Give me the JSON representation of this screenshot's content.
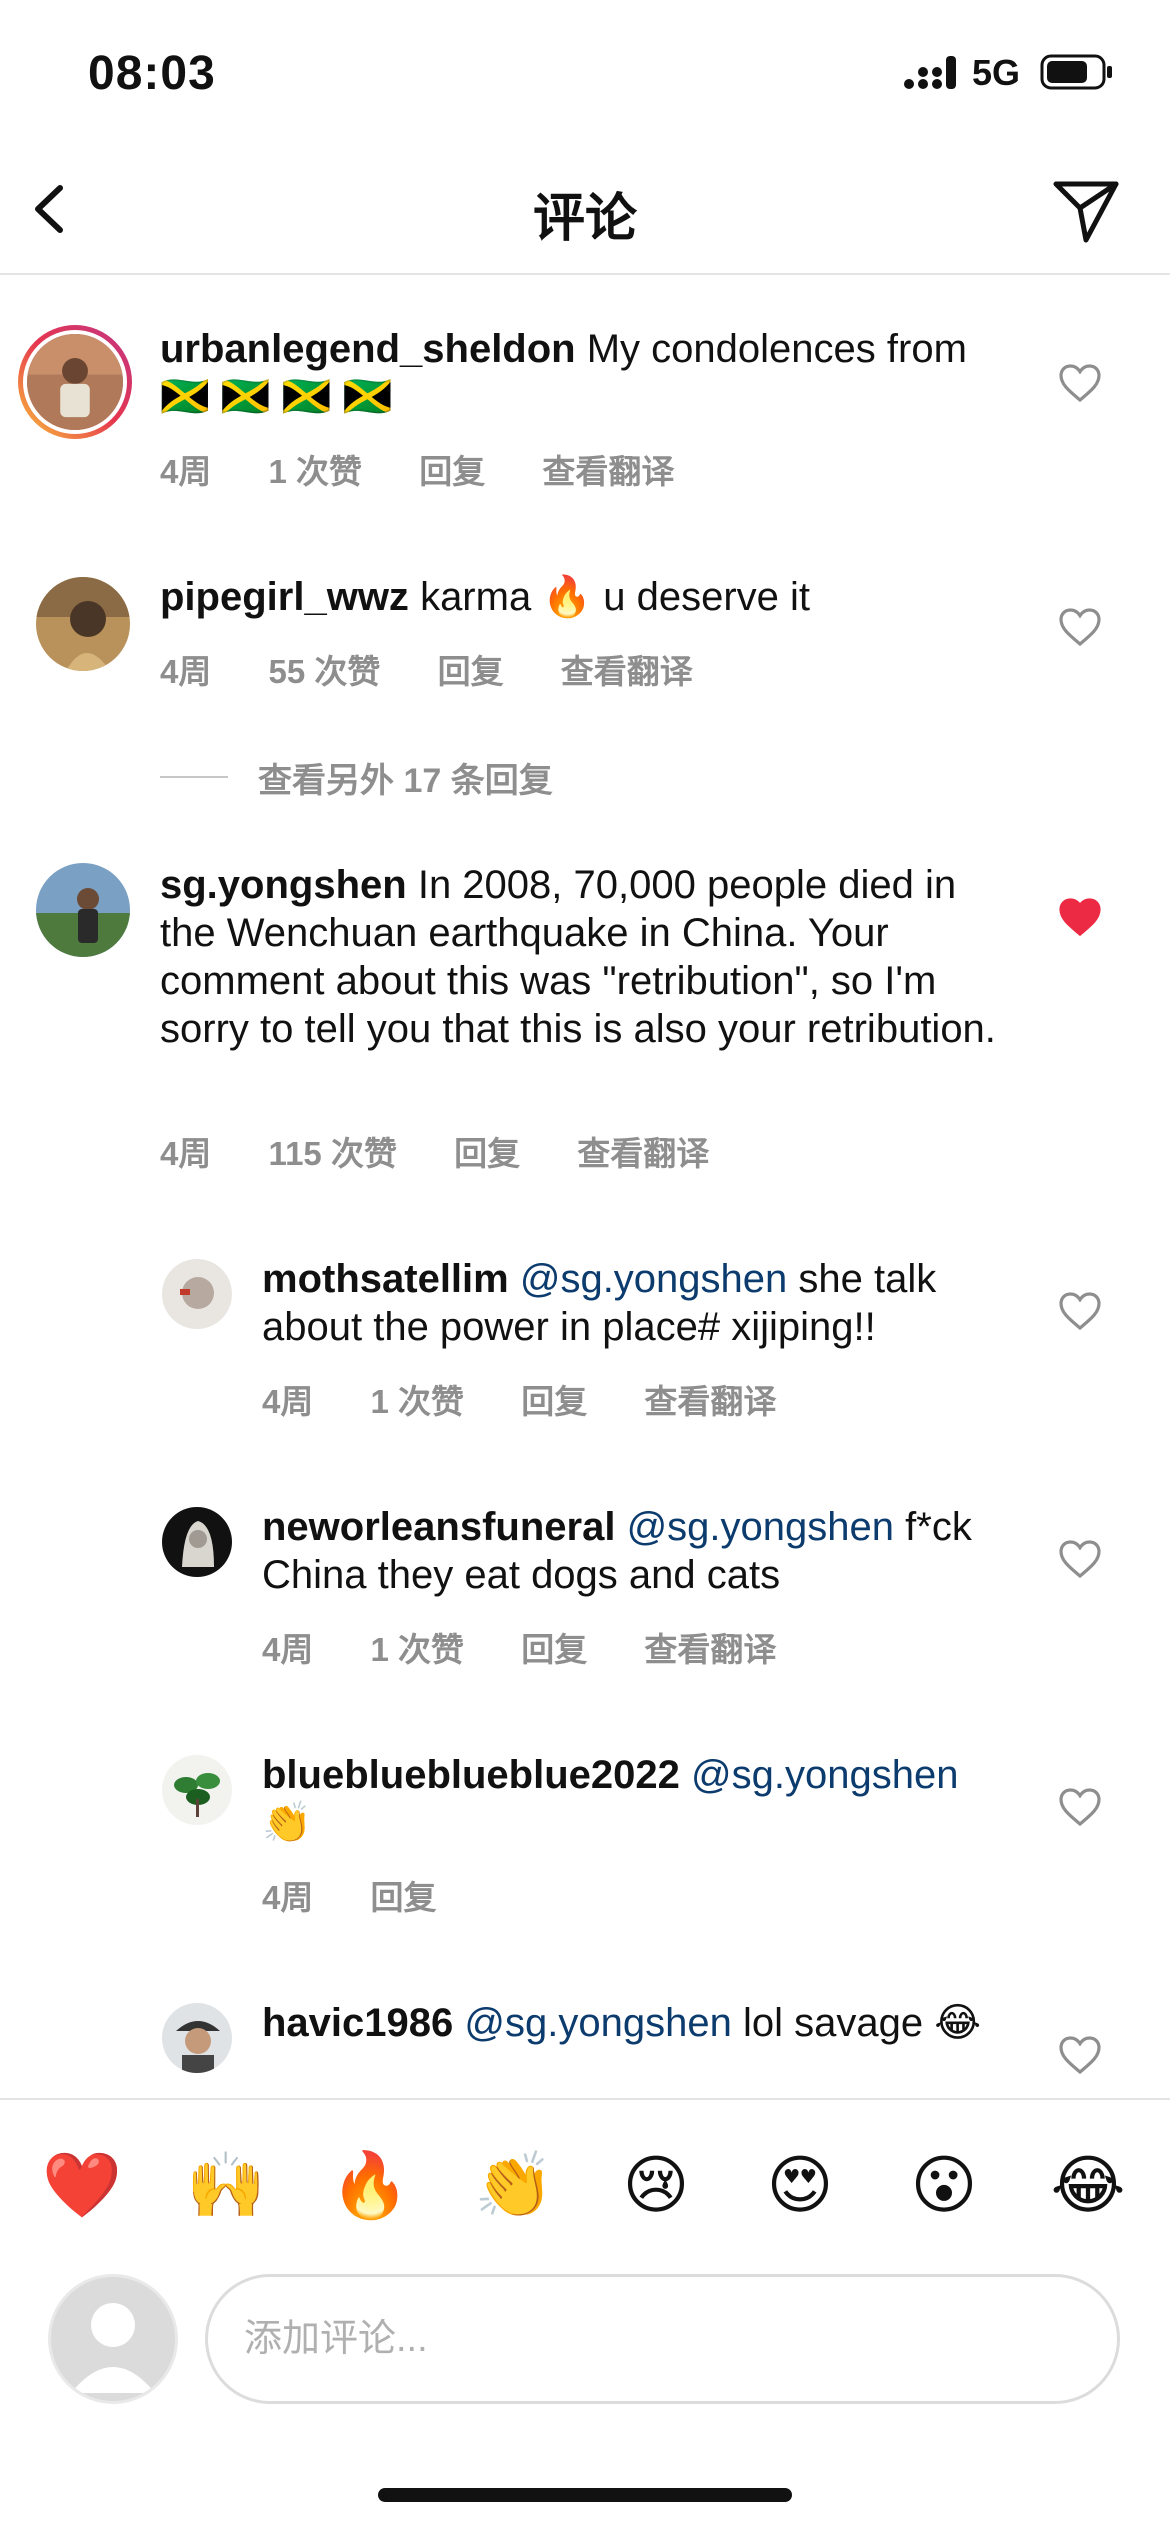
{
  "status_bar": {
    "time": "08:03",
    "network": "5G"
  },
  "header": {
    "title": "评论"
  },
  "comments": [
    {
      "username": "urbanlegend_sheldon",
      "text": "My condolences from 🇯🇲 🇯🇲 🇯🇲 🇯🇲",
      "time": "4周",
      "likes": "1 次赞",
      "reply": "回复",
      "translate": "查看翻译",
      "liked": false
    },
    {
      "username": "pipegirl_wwz",
      "text": "karma 🔥 u deserve it",
      "time": "4周",
      "likes": "55 次赞",
      "reply": "回复",
      "translate": "查看翻译",
      "liked": false
    },
    {
      "username": "sg.yongshen",
      "text": "In 2008, 70,000 people died in the Wenchuan earthquake in China. Your comment about this was \"retribution\", so I'm sorry to tell you that this is also your retribution.",
      "time": "4周",
      "likes": "115 次赞",
      "reply": "回复",
      "translate": "查看翻译",
      "liked": true
    }
  ],
  "more_replies": "查看另外 17 条回复",
  "replies": [
    {
      "username": "mothsatellim",
      "mention": "@sg.yongshen",
      "text": "she talk about the power in place# xijiping!!",
      "time": "4周",
      "likes": "1 次赞",
      "reply": "回复",
      "translate": "查看翻译"
    },
    {
      "username": "neworleansfuneral",
      "mention": "@sg.yongshen",
      "text": "f*ck China they eat dogs and cats",
      "time": "4周",
      "likes": "1 次赞",
      "reply": "回复",
      "translate": "查看翻译"
    },
    {
      "username": "blueblueblueblue2022",
      "mention": "@sg.yongshen",
      "text": "👏",
      "time": "4周",
      "reply": "回复"
    },
    {
      "username": "havic1986",
      "mention": "@sg.yongshen",
      "text": "lol savage 😂"
    }
  ],
  "emoji_bar": [
    "❤️",
    "🙌",
    "🔥",
    "👏",
    "😢",
    "😍",
    "😮",
    "😂"
  ],
  "input": {
    "placeholder": "添加评论..."
  },
  "colors": {
    "like_red": "#ed2a43",
    "mention_blue": "#0c3b6e",
    "meta_gray": "#8e8e8e"
  }
}
